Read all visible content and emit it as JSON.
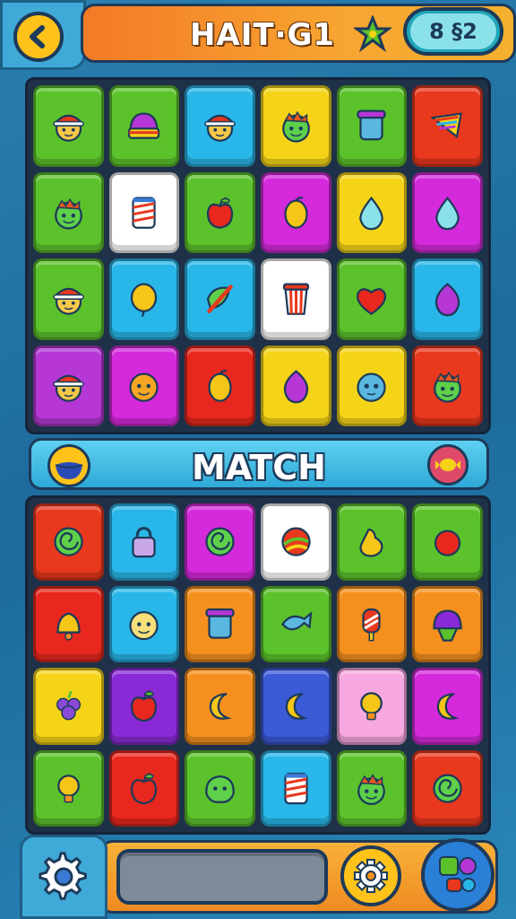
{
  "header": {
    "title": "HAIT·G1",
    "score": "8 §2",
    "back_icon": "chevron-left-icon",
    "star_icon": "star-icon"
  },
  "match_bar": {
    "label": "MATCH",
    "left_icon": "bowl-icon",
    "right_icon": "candy-icon"
  },
  "top_board": {
    "tiles": [
      {
        "bg": "#5cc22c",
        "icon": "face-hat-icon"
      },
      {
        "bg": "#5cc22c",
        "icon": "striped-beanie-icon"
      },
      {
        "bg": "#29b6e8",
        "icon": "face-hat-icon"
      },
      {
        "bg": "#f5d418",
        "icon": "green-face-icon"
      },
      {
        "bg": "#5cc22c",
        "icon": "jar-icon"
      },
      {
        "bg": "#e8381e",
        "icon": "rainbow-flag-icon"
      },
      {
        "bg": "#5cc22c",
        "icon": "green-face-icon"
      },
      {
        "bg": "#ffffff",
        "icon": "striped-cup-icon"
      },
      {
        "bg": "#5cc22c",
        "icon": "apple-icon"
      },
      {
        "bg": "#d42adb",
        "icon": "lemon-icon"
      },
      {
        "bg": "#f5d418",
        "icon": "drop-icon"
      },
      {
        "bg": "#d42adb",
        "icon": "drop-icon"
      },
      {
        "bg": "#5cc22c",
        "icon": "face-hat-icon"
      },
      {
        "bg": "#29b6e8",
        "icon": "balloon-icon"
      },
      {
        "bg": "#29b6e8",
        "icon": "pencil-leaf-icon"
      },
      {
        "bg": "#ffffff",
        "icon": "popcorn-cup-icon"
      },
      {
        "bg": "#5cc22c",
        "icon": "heart-icon"
      },
      {
        "bg": "#29b6e8",
        "icon": "plum-icon"
      },
      {
        "bg": "#b637d6",
        "icon": "face-hat-icon"
      },
      {
        "bg": "#d42adb",
        "icon": "orange-face-icon"
      },
      {
        "bg": "#e8281e",
        "icon": "lemon-icon"
      },
      {
        "bg": "#f5d418",
        "icon": "plum-icon"
      },
      {
        "bg": "#f5d418",
        "icon": "blue-face-icon"
      },
      {
        "bg": "#e8381e",
        "icon": "green-face-icon"
      }
    ]
  },
  "bottom_board": {
    "tiles": [
      {
        "bg": "#e8381e",
        "icon": "swirl-icon"
      },
      {
        "bg": "#29b6e8",
        "icon": "lock-icon"
      },
      {
        "bg": "#d42adb",
        "icon": "swirl-icon"
      },
      {
        "bg": "#ffffff",
        "icon": "ball-icon"
      },
      {
        "bg": "#5cc22c",
        "icon": "pear-icon"
      },
      {
        "bg": "#5cc22c",
        "icon": "berry-icon"
      },
      {
        "bg": "#e8281e",
        "icon": "bell-icon"
      },
      {
        "bg": "#29b6e8",
        "icon": "yellow-face-icon"
      },
      {
        "bg": "#f5901e",
        "icon": "jar-icon"
      },
      {
        "bg": "#5cc22c",
        "icon": "fish-icon"
      },
      {
        "bg": "#f5901e",
        "icon": "popsicle-icon"
      },
      {
        "bg": "#f5901e",
        "icon": "beanie-icon"
      },
      {
        "bg": "#f5d418",
        "icon": "grape-icon"
      },
      {
        "bg": "#8a2ad6",
        "icon": "apple-icon"
      },
      {
        "bg": "#f5901e",
        "icon": "crescent-icon"
      },
      {
        "bg": "#3a5ad6",
        "icon": "crescent-icon"
      },
      {
        "bg": "#f7a8e0",
        "icon": "bulb-icon"
      },
      {
        "bg": "#d42adb",
        "icon": "crescent-icon"
      },
      {
        "bg": "#5cc22c",
        "icon": "bulb-icon"
      },
      {
        "bg": "#e8281e",
        "icon": "apple-icon"
      },
      {
        "bg": "#5cc22c",
        "icon": "green-monster-icon"
      },
      {
        "bg": "#29b6e8",
        "icon": "striped-cup-icon"
      },
      {
        "bg": "#5cc22c",
        "icon": "green-face-icon"
      },
      {
        "bg": "#e8381e",
        "icon": "swirl-icon"
      }
    ]
  },
  "bottom_bar": {
    "settings_icon": "gear-icon",
    "gear_icon": "gear-icon",
    "shapes_icon": "shapes-icon"
  }
}
